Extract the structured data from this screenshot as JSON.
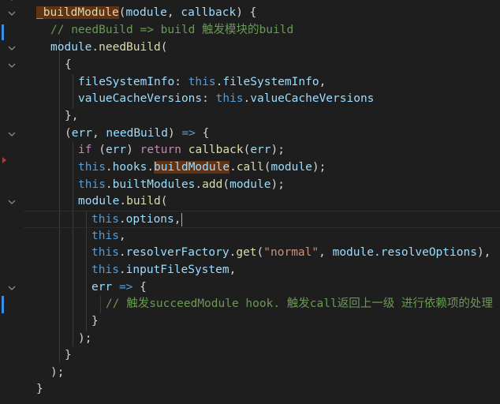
{
  "editor": {
    "theme_colors": {
      "background": "#1e1e1e",
      "keyword": "#569cd6",
      "control": "#c586c0",
      "function": "#dcdcaa",
      "variable": "#9cdcfe",
      "string": "#ce9178",
      "comment": "#6a9955"
    },
    "fold_icons": [
      "chevron-down-icon"
    ],
    "lines": [
      {
        "tokens": [
          {
            "t": "_buildModule",
            "c": "fn",
            "hl": true
          },
          {
            "t": "(",
            "c": "pun"
          },
          {
            "t": "module",
            "c": "var"
          },
          {
            "t": ", ",
            "c": "pun"
          },
          {
            "t": "callback",
            "c": "var"
          },
          {
            "t": ") {",
            "c": "pun"
          }
        ]
      },
      {
        "tokens": [
          {
            "t": "// needBuild => build 触发模块的build",
            "c": "com"
          }
        ]
      },
      {
        "tokens": [
          {
            "t": "module",
            "c": "var"
          },
          {
            "t": ".",
            "c": "pun"
          },
          {
            "t": "needBuild",
            "c": "fn"
          },
          {
            "t": "(",
            "c": "pun"
          }
        ]
      },
      {
        "tokens": [
          {
            "t": "{",
            "c": "pun"
          }
        ]
      },
      {
        "tokens": [
          {
            "t": "fileSystemInfo",
            "c": "prop"
          },
          {
            "t": ": ",
            "c": "pun"
          },
          {
            "t": "this",
            "c": "kw"
          },
          {
            "t": ".",
            "c": "pun"
          },
          {
            "t": "fileSystemInfo",
            "c": "prop"
          },
          {
            "t": ",",
            "c": "pun"
          }
        ]
      },
      {
        "tokens": [
          {
            "t": "valueCacheVersions",
            "c": "prop"
          },
          {
            "t": ": ",
            "c": "pun"
          },
          {
            "t": "this",
            "c": "kw"
          },
          {
            "t": ".",
            "c": "pun"
          },
          {
            "t": "valueCacheVersions",
            "c": "prop"
          }
        ]
      },
      {
        "tokens": [
          {
            "t": "},",
            "c": "pun"
          }
        ]
      },
      {
        "tokens": [
          {
            "t": "(",
            "c": "pun"
          },
          {
            "t": "err",
            "c": "var"
          },
          {
            "t": ", ",
            "c": "pun"
          },
          {
            "t": "needBuild",
            "c": "var"
          },
          {
            "t": ") ",
            "c": "pun"
          },
          {
            "t": "=>",
            "c": "kw"
          },
          {
            "t": " {",
            "c": "pun"
          }
        ]
      },
      {
        "tokens": [
          {
            "t": "if",
            "c": "ctl"
          },
          {
            "t": " (",
            "c": "pun"
          },
          {
            "t": "err",
            "c": "var"
          },
          {
            "t": ") ",
            "c": "pun"
          },
          {
            "t": "return",
            "c": "ctl"
          },
          {
            "t": " ",
            "c": "pun"
          },
          {
            "t": "callback",
            "c": "fn"
          },
          {
            "t": "(",
            "c": "pun"
          },
          {
            "t": "err",
            "c": "var"
          },
          {
            "t": ");",
            "c": "pun"
          }
        ]
      },
      {
        "tokens": [
          {
            "t": "this",
            "c": "kw"
          },
          {
            "t": ".",
            "c": "pun"
          },
          {
            "t": "hooks",
            "c": "prop"
          },
          {
            "t": ".",
            "c": "pun"
          },
          {
            "t": "buildModule",
            "c": "prop",
            "hl": true
          },
          {
            "t": ".",
            "c": "pun"
          },
          {
            "t": "call",
            "c": "fn"
          },
          {
            "t": "(",
            "c": "pun"
          },
          {
            "t": "module",
            "c": "var"
          },
          {
            "t": ");",
            "c": "pun"
          }
        ]
      },
      {
        "tokens": [
          {
            "t": "this",
            "c": "kw"
          },
          {
            "t": ".",
            "c": "pun"
          },
          {
            "t": "builtModules",
            "c": "prop"
          },
          {
            "t": ".",
            "c": "pun"
          },
          {
            "t": "add",
            "c": "fn"
          },
          {
            "t": "(",
            "c": "pun"
          },
          {
            "t": "module",
            "c": "var"
          },
          {
            "t": ");",
            "c": "pun"
          }
        ]
      },
      {
        "tokens": [
          {
            "t": "module",
            "c": "var"
          },
          {
            "t": ".",
            "c": "pun"
          },
          {
            "t": "build",
            "c": "fn"
          },
          {
            "t": "(",
            "c": "pun"
          }
        ]
      },
      {
        "tokens": [
          {
            "t": "this",
            "c": "kw"
          },
          {
            "t": ".",
            "c": "pun"
          },
          {
            "t": "options",
            "c": "prop"
          },
          {
            "t": ",",
            "c": "pun"
          }
        ]
      },
      {
        "tokens": [
          {
            "t": "this",
            "c": "kw"
          },
          {
            "t": ",",
            "c": "pun"
          }
        ]
      },
      {
        "tokens": [
          {
            "t": "this",
            "c": "kw"
          },
          {
            "t": ".",
            "c": "pun"
          },
          {
            "t": "resolverFactory",
            "c": "prop"
          },
          {
            "t": ".",
            "c": "pun"
          },
          {
            "t": "get",
            "c": "fn"
          },
          {
            "t": "(",
            "c": "pun"
          },
          {
            "t": "\"normal\"",
            "c": "str"
          },
          {
            "t": ", ",
            "c": "pun"
          },
          {
            "t": "module",
            "c": "var"
          },
          {
            "t": ".",
            "c": "pun"
          },
          {
            "t": "resolveOptions",
            "c": "prop"
          },
          {
            "t": "),",
            "c": "pun"
          }
        ]
      },
      {
        "tokens": [
          {
            "t": "this",
            "c": "kw"
          },
          {
            "t": ".",
            "c": "pun"
          },
          {
            "t": "inputFileSystem",
            "c": "prop"
          },
          {
            "t": ",",
            "c": "pun"
          }
        ]
      },
      {
        "tokens": [
          {
            "t": "err",
            "c": "var"
          },
          {
            "t": " ",
            "c": "pun"
          },
          {
            "t": "=>",
            "c": "kw"
          },
          {
            "t": " {",
            "c": "pun"
          }
        ]
      },
      {
        "tokens": [
          {
            "t": "// 触发succeedModule hook. 触发call返回上一级 进行依赖项的处理",
            "c": "com"
          }
        ]
      },
      {
        "tokens": [
          {
            "t": "}",
            "c": "pun"
          }
        ]
      },
      {
        "tokens": [
          {
            "t": ");",
            "c": "pun"
          }
        ]
      },
      {
        "tokens": [
          {
            "t": "}",
            "c": "pun"
          }
        ]
      },
      {
        "tokens": [
          {
            "t": ");",
            "c": "pun"
          }
        ]
      },
      {
        "tokens": [
          {
            "t": "}",
            "c": "pun"
          }
        ]
      }
    ]
  }
}
